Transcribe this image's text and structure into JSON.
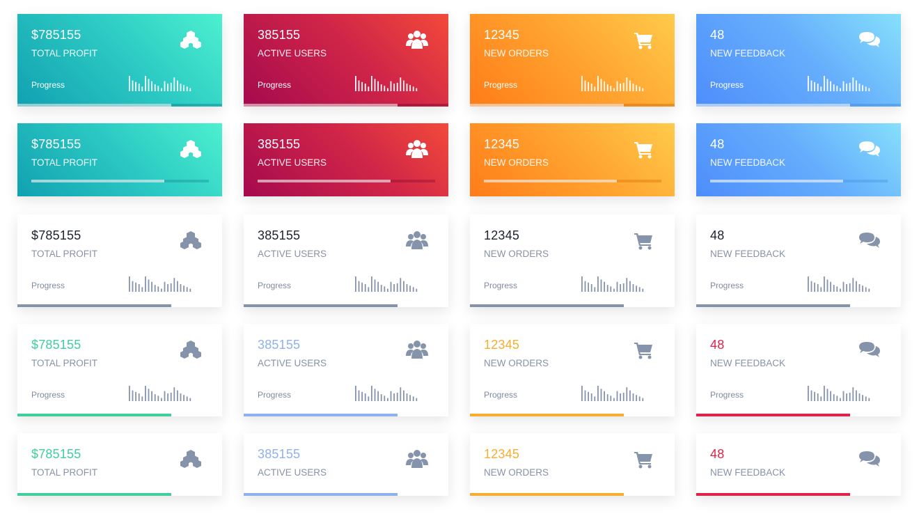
{
  "colors": {
    "teal": "#2dcbc4",
    "red": "#cf2448",
    "orange": "#ffa531",
    "blue": "#66aefc",
    "slate": "#8593ab",
    "profit_text": "#3ecf9a",
    "users_text": "#8fb0ef",
    "orders_text": "#f7ad2f",
    "feedback_text": "#e0224a"
  },
  "progress_label": "Progress",
  "progress_value": 0.75,
  "sparkline": [
    20,
    14,
    12,
    10,
    6,
    20,
    16,
    13,
    9,
    7,
    4,
    13,
    10,
    11,
    18,
    14,
    10,
    8,
    6,
    4
  ],
  "metrics": [
    {
      "value": "$785155",
      "label": "TOTAL PROFIT",
      "icon": "cubes-icon"
    },
    {
      "value": "385155",
      "label": "ACTIVE USERS",
      "icon": "users-icon"
    },
    {
      "value": "12345",
      "label": "NEW ORDERS",
      "icon": "cart-icon"
    },
    {
      "value": "48",
      "label": "NEW FEEDBACK",
      "icon": "comments-icon"
    }
  ]
}
